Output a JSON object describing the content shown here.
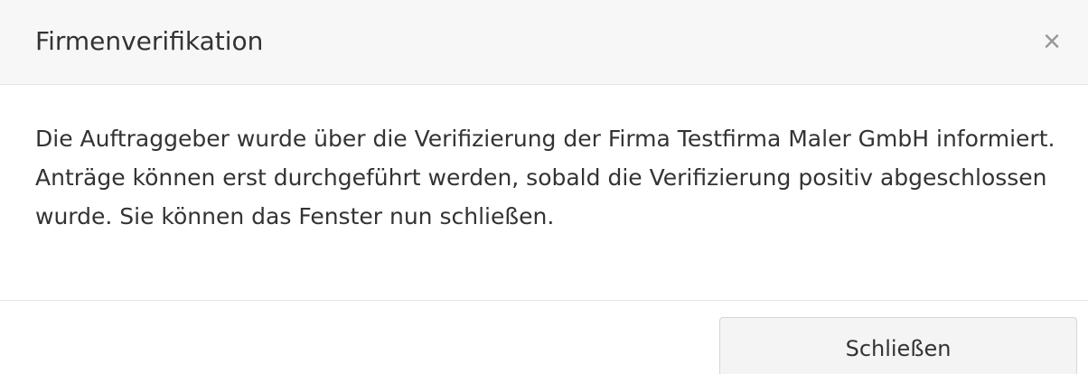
{
  "dialog": {
    "title": "Firmenverifikation",
    "close_icon": "close-icon",
    "close_glyph": "×",
    "message": "Die Auftraggeber wurde über die Verifizierung der Firma Testfirma Maler GmbH informiert. Anträge können erst durchgeführt werden, sobald die Verifizierung positiv abgeschlossen wurde. Sie können das Fenster nun schließen.",
    "close_button_label": "Schließen"
  },
  "colors": {
    "header_background": "#f7f7f7",
    "text": "#333333",
    "close_icon": "#999999",
    "button_background": "#f4f4f4",
    "border": "#e6e6e6"
  }
}
